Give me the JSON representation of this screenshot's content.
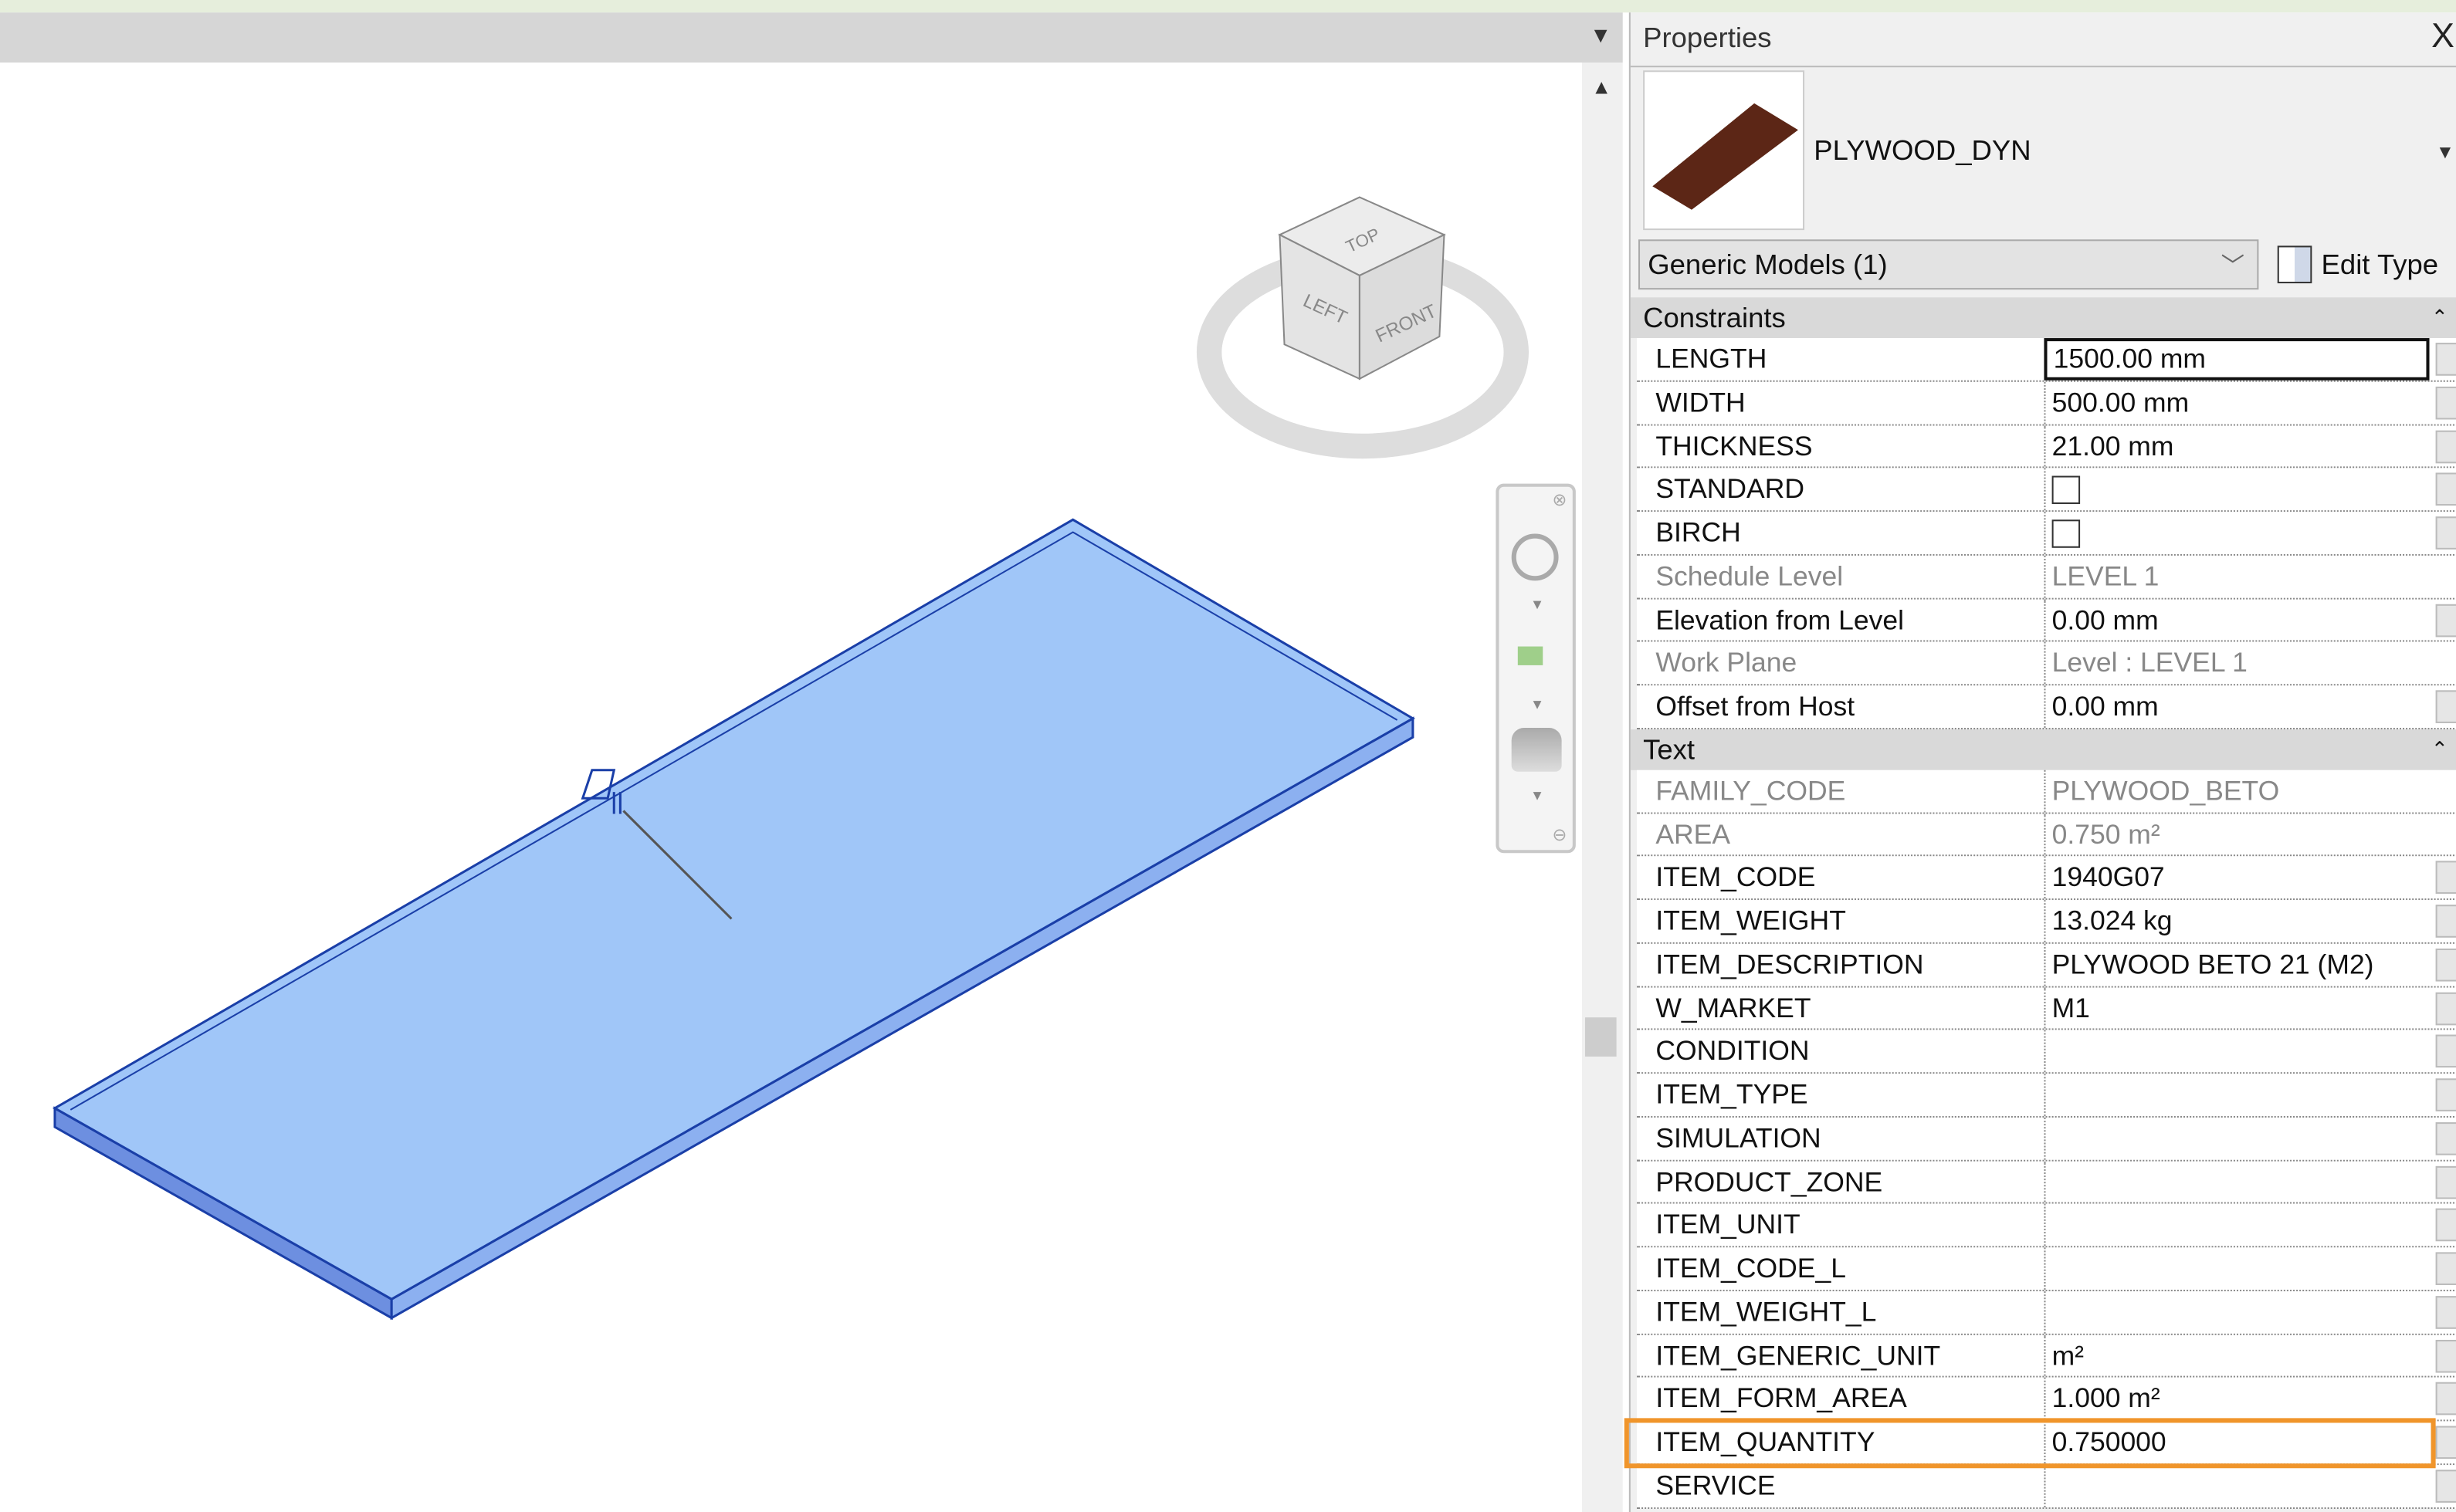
{
  "view": {
    "viewcube": {
      "top": "TOP",
      "left": "LEFT",
      "front": "FRONT"
    },
    "element_color": "#a0c6f8",
    "edge_color": "#1a3fa8"
  },
  "properties": {
    "title": "Properties",
    "close_label": "X",
    "type_name": "PLYWOOD_DYN",
    "thumbnail_color": "#5c2616",
    "category_selector": "Generic Models (1)",
    "edit_type_label": "Edit Type",
    "sections": [
      {
        "name": "Constraints",
        "rows": [
          {
            "key": "LENGTH",
            "value": "1500.00 mm"
          },
          {
            "key": "WIDTH",
            "value": "500.00 mm"
          },
          {
            "key": "THICKNESS",
            "value": "21.00 mm"
          },
          {
            "key": "STANDARD",
            "checked": false
          },
          {
            "key": "BIRCH",
            "checked": false
          },
          {
            "key": "Schedule Level",
            "value": "LEVEL 1",
            "readonly": true
          },
          {
            "key": "Elevation from Level",
            "value": "0.00 mm"
          },
          {
            "key": "Work Plane",
            "value": "Level : LEVEL 1",
            "readonly": true
          },
          {
            "key": "Offset from Host",
            "value": "0.00 mm"
          }
        ]
      },
      {
        "name": "Text",
        "rows": [
          {
            "key": "FAMILY_CODE",
            "value": "PLYWOOD_BETO",
            "readonly": true
          },
          {
            "key": "AREA",
            "value": "0.750 m²",
            "readonly": true
          },
          {
            "key": "ITEM_CODE",
            "value": "1940G07"
          },
          {
            "key": "ITEM_WEIGHT",
            "value": "13.024 kg"
          },
          {
            "key": "ITEM_DESCRIPTION",
            "value": "PLYWOOD BETO 21 (M2)"
          },
          {
            "key": "W_MARKET",
            "value": "M1"
          },
          {
            "key": "CONDITION",
            "value": ""
          },
          {
            "key": "ITEM_TYPE",
            "value": ""
          },
          {
            "key": "SIMULATION",
            "value": ""
          },
          {
            "key": "PRODUCT_ZONE",
            "value": ""
          },
          {
            "key": "ITEM_UNIT",
            "value": ""
          },
          {
            "key": "ITEM_CODE_L",
            "value": ""
          },
          {
            "key": "ITEM_WEIGHT_L",
            "value": ""
          },
          {
            "key": "ITEM_GENERIC_UNIT",
            "value": "m²"
          },
          {
            "key": "ITEM_FORM_AREA",
            "value": "1.000 m²"
          },
          {
            "key": "ITEM_QUANTITY",
            "value": "0.750000",
            "highlighted": true
          },
          {
            "key": "SERVICE",
            "value": ""
          }
        ]
      }
    ],
    "highlight_color": "#f0952b"
  }
}
